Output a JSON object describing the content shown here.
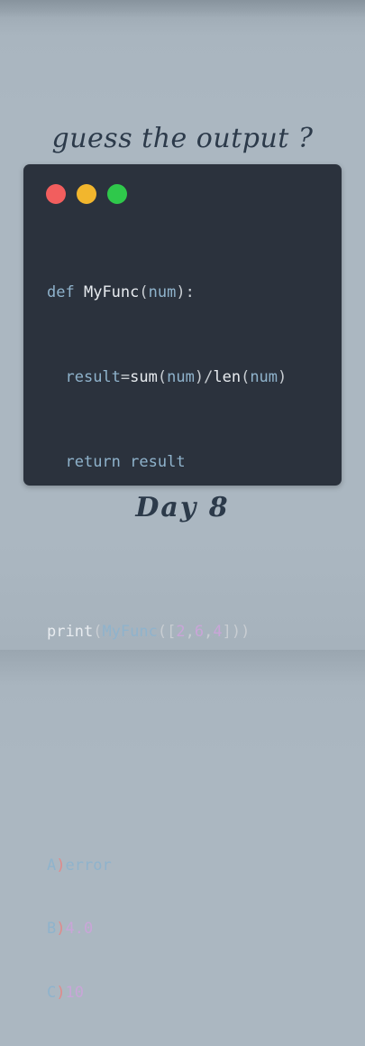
{
  "headline": "guess the output ?",
  "code": {
    "line1": {
      "kw": "def",
      "name": "MyFunc",
      "open": "(",
      "param": "num",
      "close": "):"
    },
    "line2": {
      "indent": "  ",
      "lhs": "result",
      "eq": "=",
      "f1": "sum",
      "p1o": "(",
      "a1": "num",
      "p1c": ")",
      "div": "/",
      "f2": "len",
      "p2o": "(",
      "a2": "num",
      "p2c": ")"
    },
    "line3": {
      "indent": "  ",
      "kw": "return",
      "val": "result"
    },
    "line5": {
      "fn": "print",
      "o1": "(",
      "call": "MyFunc",
      "o2": "(",
      "lb": "[",
      "n1": "2",
      "c1": ",",
      "n2": "6",
      "c2": ",",
      "n3": "4",
      "rb": "]",
      "c3": "))"
    }
  },
  "options": [
    {
      "letter": "A",
      "paren": ")",
      "text": "error"
    },
    {
      "letter": "B",
      "paren": ")",
      "text": "4.0"
    },
    {
      "letter": "C",
      "paren": ")",
      "text": "10"
    }
  ],
  "day_label": "Day 8",
  "colors": {
    "background": "#abb7c1",
    "window": "#2b323d",
    "close": "#f25e5e",
    "minimize": "#f2b62d",
    "maximize": "#2fc84b"
  }
}
